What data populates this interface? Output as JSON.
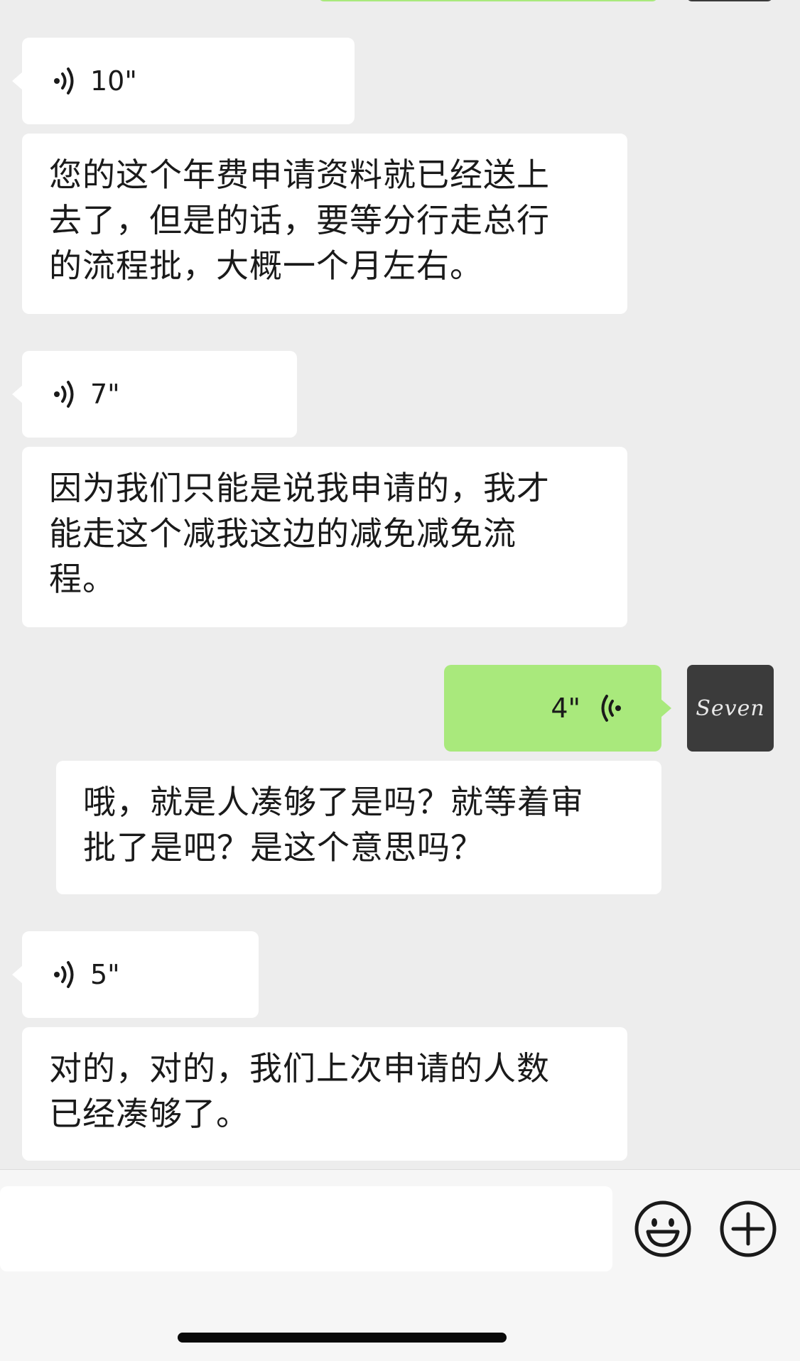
{
  "messages": [
    {
      "type": "voice",
      "side": "left",
      "duration": "10\""
    },
    {
      "type": "text",
      "side": "left",
      "lines": [
        "您的这个年费申请资料就已经送上",
        "去了，但是的话，要等分行走总行",
        "的流程批，大概一个月左右。"
      ]
    },
    {
      "type": "voice",
      "side": "left",
      "duration": "7\""
    },
    {
      "type": "text",
      "side": "left",
      "lines": [
        "因为我们只能是说我申请的，我才",
        "能走这个减我这边的减免减免流",
        "程。"
      ]
    },
    {
      "type": "voice",
      "side": "right",
      "duration": "4\""
    },
    {
      "type": "text",
      "side": "right",
      "lines": [
        "哦，就是人凑够了是吗？就等着审",
        "批了是吧？是这个意思吗？"
      ]
    },
    {
      "type": "voice",
      "side": "left",
      "duration": "5\""
    },
    {
      "type": "text",
      "side": "left",
      "lines": [
        "对的，对的，我们上次申请的人数",
        "已经凑够了。"
      ]
    }
  ],
  "avatar": {
    "text": "Seven",
    "icon": "avatar-signature"
  },
  "input": {
    "value": "",
    "placeholder": ""
  },
  "toolbar": {
    "emoji_icon": "smiley-icon",
    "more_icon": "plus-circle-icon"
  },
  "colors": {
    "background": "#ededed",
    "bubble_in": "#ffffff",
    "bubble_out": "#a9e97c",
    "avatar_bg": "#3b3b3b"
  }
}
